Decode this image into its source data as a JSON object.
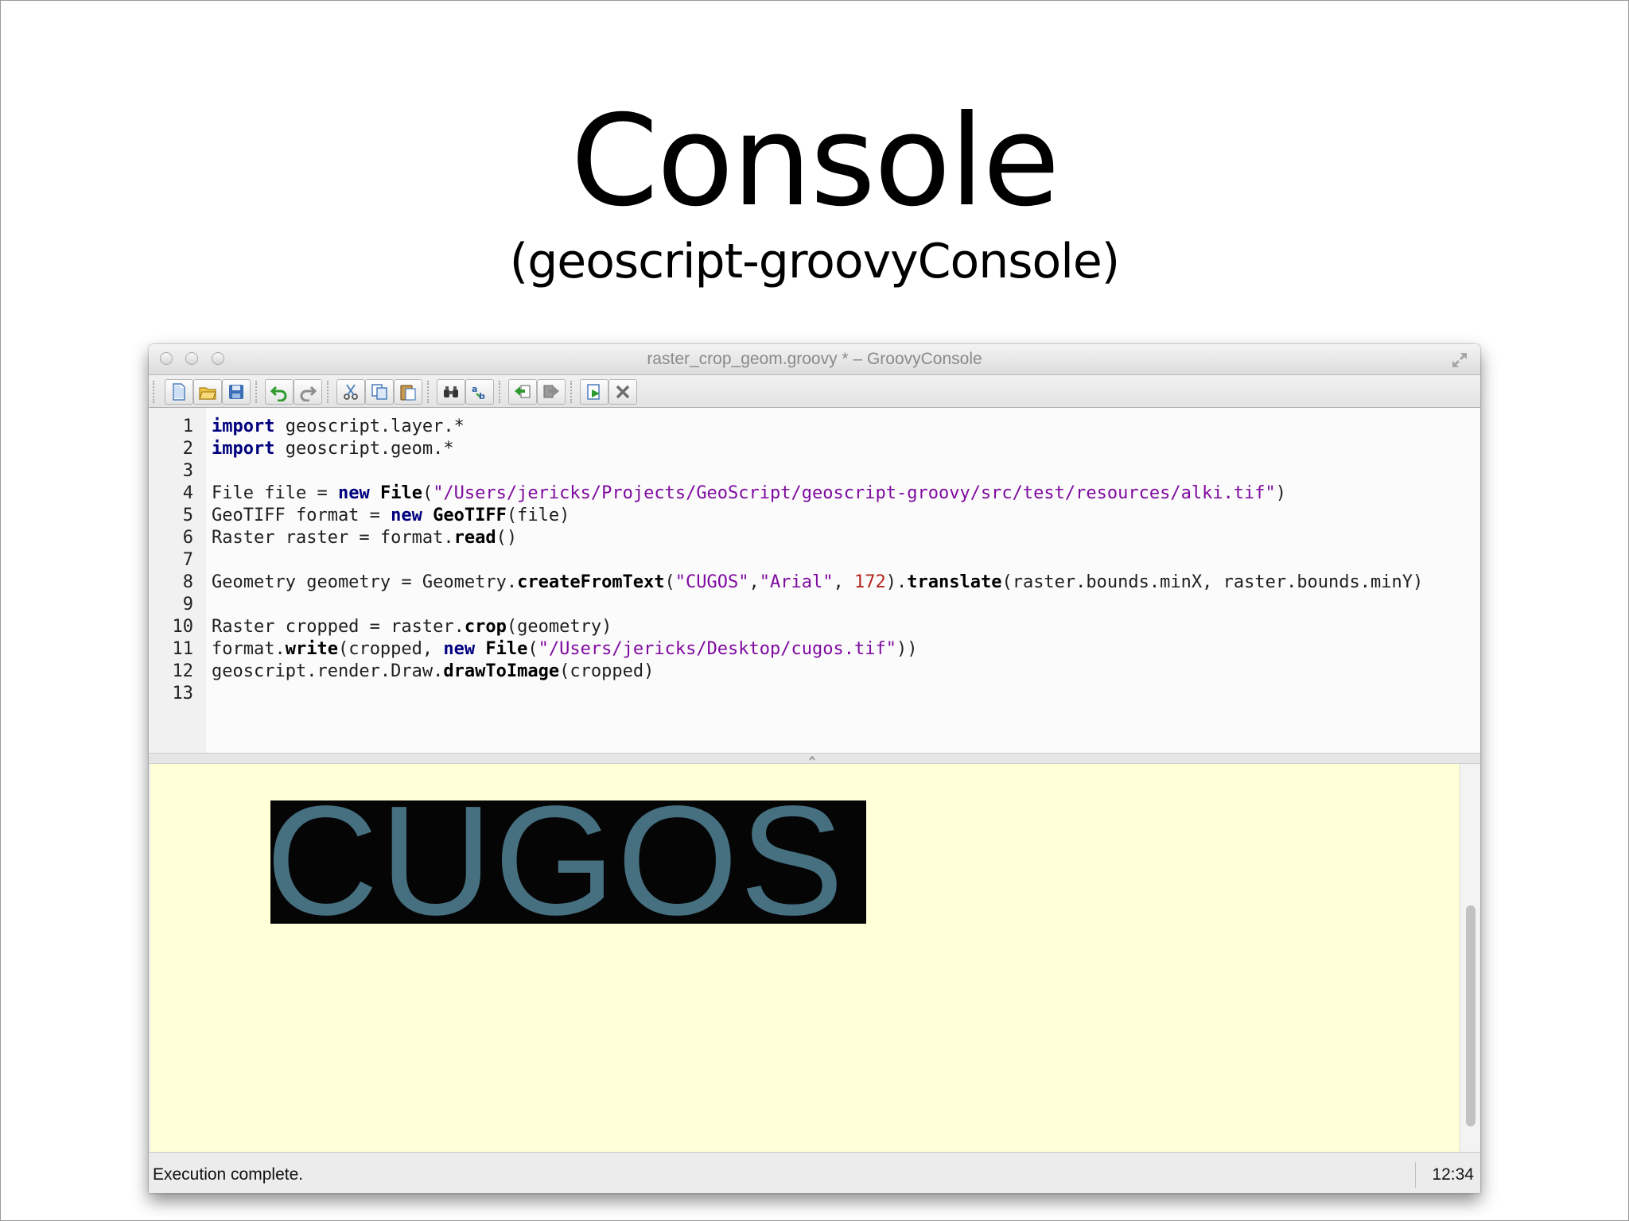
{
  "slide": {
    "title": "Console",
    "subtitle": "(geoscript-groovyConsole)"
  },
  "window": {
    "title": "raster_crop_geom.groovy *  – GroovyConsole",
    "toolbar": [
      {
        "name": "new-file-icon"
      },
      {
        "name": "open-file-icon"
      },
      {
        "name": "save-file-icon"
      },
      {
        "name": "undo-icon"
      },
      {
        "name": "redo-icon"
      },
      {
        "name": "cut-icon"
      },
      {
        "name": "copy-icon"
      },
      {
        "name": "paste-icon"
      },
      {
        "name": "find-icon"
      },
      {
        "name": "replace-icon"
      },
      {
        "name": "history-previous-icon"
      },
      {
        "name": "history-next-icon"
      },
      {
        "name": "run-script-icon"
      },
      {
        "name": "interrupt-icon"
      }
    ]
  },
  "editor": {
    "line_numbers": [
      "1",
      "2",
      "3",
      "4",
      "5",
      "6",
      "7",
      "8",
      "9",
      "10",
      "11",
      "12",
      "13"
    ],
    "lines": [
      [
        {
          "t": "import",
          "c": "kw"
        },
        {
          "t": " geoscript.layer.*"
        }
      ],
      [
        {
          "t": "import",
          "c": "kw"
        },
        {
          "t": " geoscript.geom.*"
        }
      ],
      [],
      [
        {
          "t": "File file = "
        },
        {
          "t": "new",
          "c": "kw"
        },
        {
          "t": " "
        },
        {
          "t": "File",
          "c": "fn"
        },
        {
          "t": "("
        },
        {
          "t": "\"/Users/jericks/Projects/GeoScript/geoscript-groovy/src/test/resources/alki.tif\"",
          "c": "str"
        },
        {
          "t": ")"
        }
      ],
      [
        {
          "t": "GeoTIFF format = "
        },
        {
          "t": "new",
          "c": "kw"
        },
        {
          "t": " "
        },
        {
          "t": "GeoTIFF",
          "c": "fn"
        },
        {
          "t": "(file)"
        }
      ],
      [
        {
          "t": "Raster raster = format."
        },
        {
          "t": "read",
          "c": "fn"
        },
        {
          "t": "()"
        }
      ],
      [],
      [
        {
          "t": "Geometry geometry = Geometry."
        },
        {
          "t": "createFromText",
          "c": "fn"
        },
        {
          "t": "("
        },
        {
          "t": "\"CUGOS\"",
          "c": "str"
        },
        {
          "t": ","
        },
        {
          "t": "\"Arial\"",
          "c": "str"
        },
        {
          "t": ", "
        },
        {
          "t": "172",
          "c": "num"
        },
        {
          "t": ")."
        },
        {
          "t": "translate",
          "c": "fn"
        },
        {
          "t": "(raster.bounds.minX, raster.bounds.minY)"
        }
      ],
      [],
      [
        {
          "t": "Raster cropped = raster."
        },
        {
          "t": "crop",
          "c": "fn"
        },
        {
          "t": "(geometry)"
        }
      ],
      [
        {
          "t": "format."
        },
        {
          "t": "write",
          "c": "fn"
        },
        {
          "t": "(cropped, "
        },
        {
          "t": "new",
          "c": "kw"
        },
        {
          "t": " "
        },
        {
          "t": "File",
          "c": "fn"
        },
        {
          "t": "("
        },
        {
          "t": "\"/Users/jericks/Desktop/cugos.tif\"",
          "c": "str"
        },
        {
          "t": "))"
        }
      ],
      [
        {
          "t": "geoscript.render.Draw."
        },
        {
          "t": "drawToImage",
          "c": "fn"
        },
        {
          "t": "(cropped)"
        }
      ],
      []
    ]
  },
  "output": {
    "image_text": "CUGOS"
  },
  "status": {
    "message": "Execution complete.",
    "time": "12:34"
  }
}
